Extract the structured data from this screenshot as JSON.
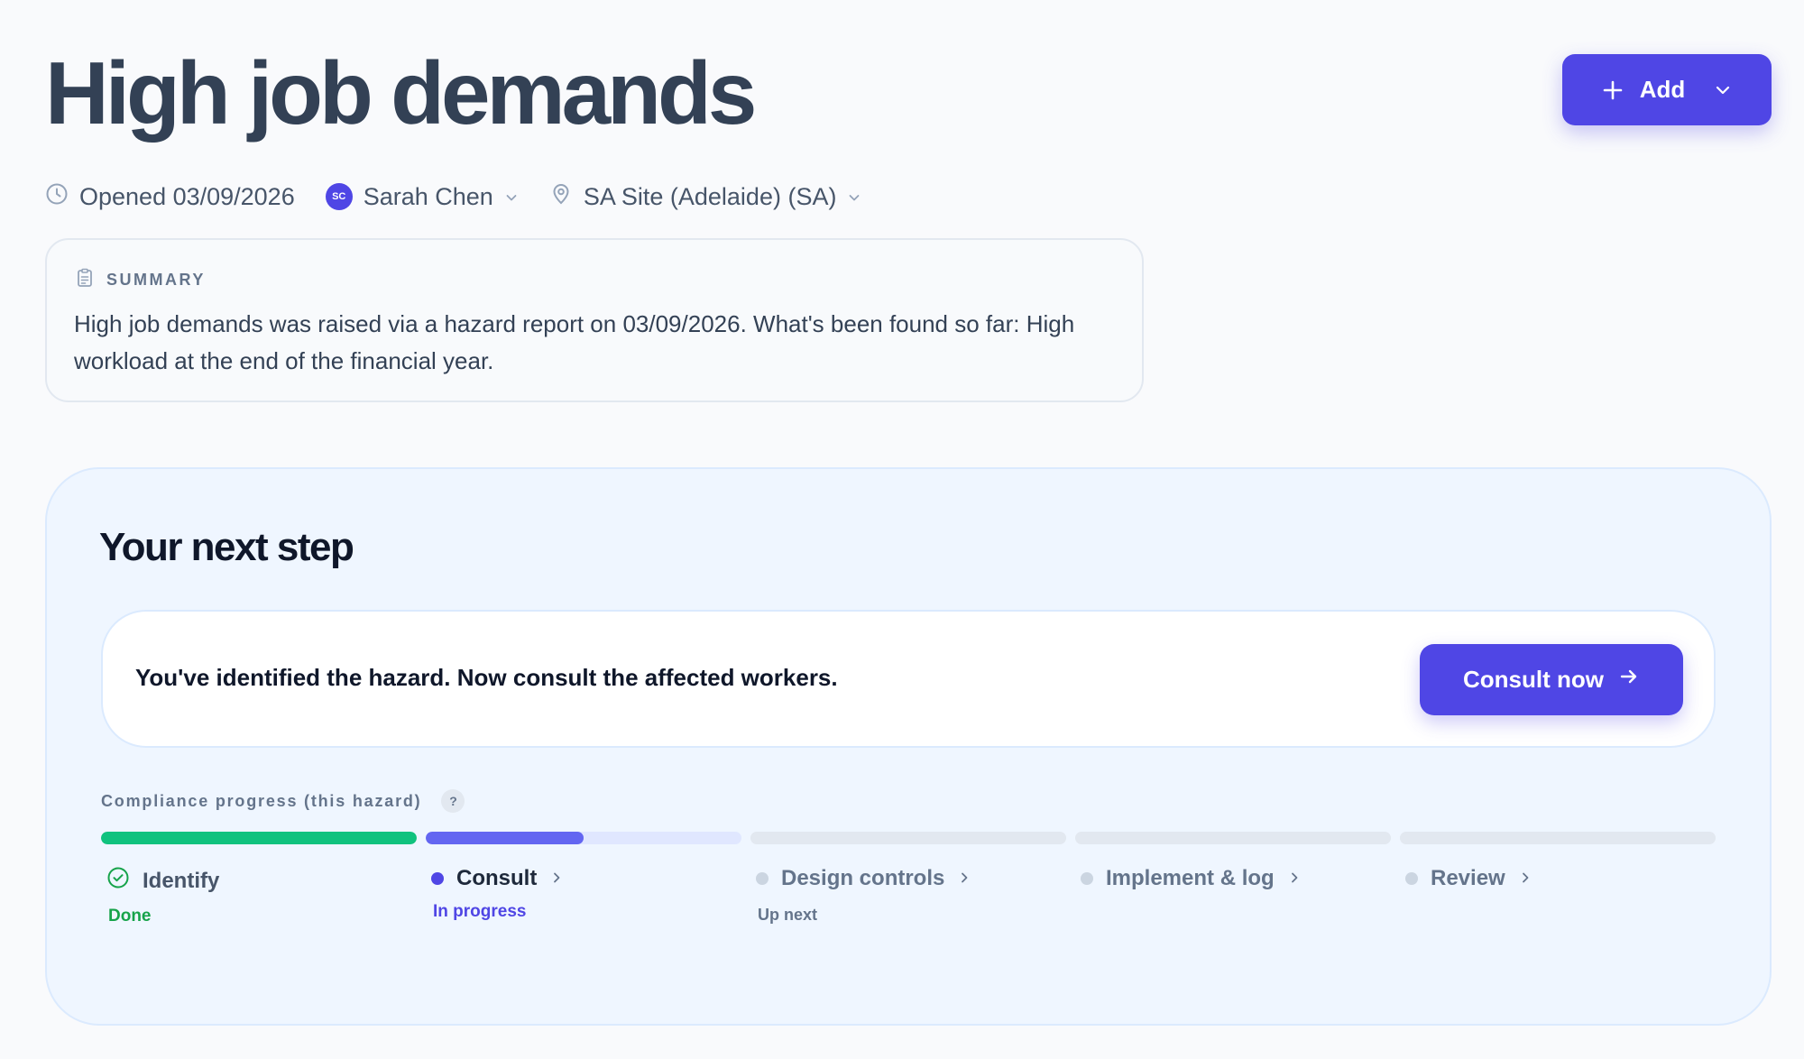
{
  "header": {
    "title": "High job demands",
    "add_label": "Add"
  },
  "meta": {
    "opened": "Opened 03/09/2026",
    "assignee_initials": "SC",
    "assignee_name": "Sarah Chen",
    "site": "SA Site (Adelaide) (SA)"
  },
  "summary": {
    "label": "SUMMARY",
    "text": "High job demands was raised via a hazard report on 03/09/2026. What's been found so far: High workload at the end of the financial year."
  },
  "next_step": {
    "title": "Your next step",
    "message": "You've identified the hazard. Now consult the affected workers.",
    "button_label": "Consult now"
  },
  "progress": {
    "label": "Compliance progress (this hazard)",
    "help": "?",
    "steps": [
      {
        "label": "Identify",
        "status": "Done",
        "state": "done",
        "fill": 1.0,
        "color": "#10c27e"
      },
      {
        "label": "Consult",
        "status": "In progress",
        "state": "active",
        "fill": 0.5,
        "color": "#6366f1"
      },
      {
        "label": "Design controls",
        "status": "Up next",
        "state": "pending",
        "fill": 0,
        "color": "#cbd5e1"
      },
      {
        "label": "Implement & log",
        "status": "",
        "state": "pending",
        "fill": 0,
        "color": "#cbd5e1"
      },
      {
        "label": "Review",
        "status": "",
        "state": "pending",
        "fill": 0,
        "color": "#cbd5e1"
      }
    ]
  },
  "colors": {
    "accent": "#4f46e5",
    "done": "#16a34a",
    "progress_track_active": "#e0e7ff"
  },
  "icons": [
    "plus-icon",
    "chevron-down-icon",
    "clock-icon",
    "location-pin-icon",
    "clipboard-icon",
    "arrow-right-icon",
    "check-circle-icon",
    "chevron-right-icon"
  ]
}
